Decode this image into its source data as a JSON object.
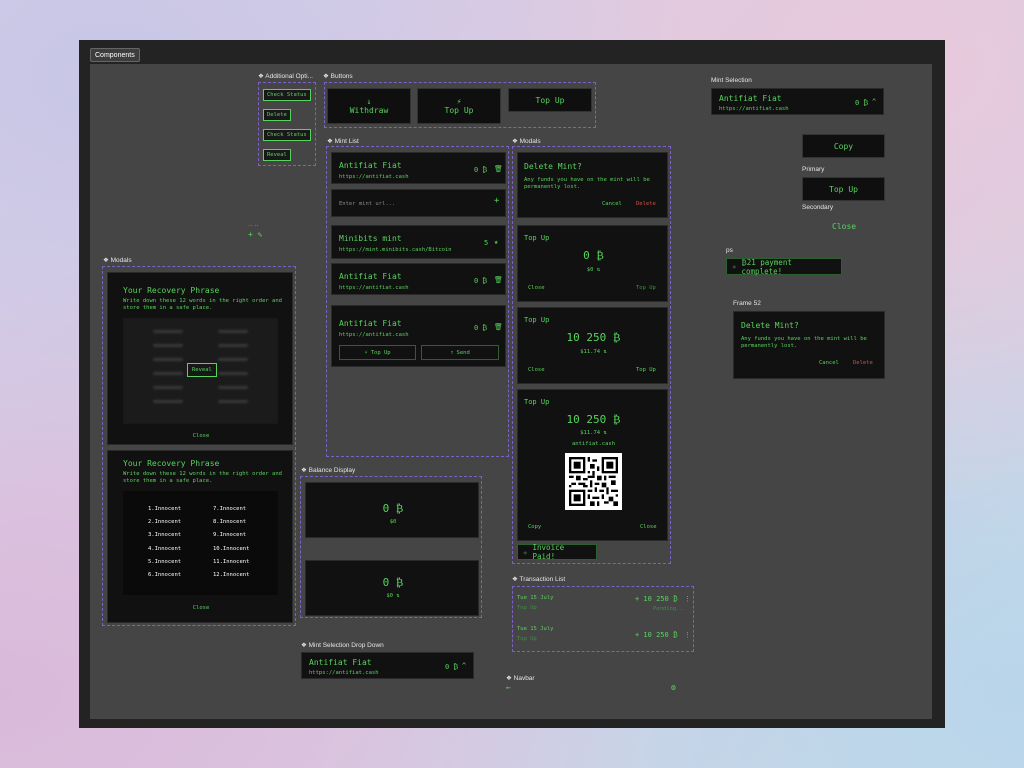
{
  "tab": "Components",
  "labels": {
    "additional": "❖ Additional Opti...",
    "buttons": "❖ Buttons",
    "mint_list": "❖ Mint List",
    "modals_center": "❖ Modals",
    "modals_left": "❖ Modals",
    "balance_display": "❖ Balance Display",
    "mint_dropdown": "❖ Mint Selection Drop Down",
    "transaction_list": "❖ Transaction List",
    "navbar": "❖ Navbar",
    "mint_selection": "Mint Selection",
    "primary": "Primary",
    "secondary": "Secondary",
    "ps": "ps",
    "frame52": "Frame 52",
    "dots": "·· ··"
  },
  "additional_options": [
    "Check Status",
    "Delete",
    "Check Status",
    "Reveal"
  ],
  "buttons": {
    "withdraw": "Withdraw",
    "top_up": "Top Up",
    "top_up_plain": "Top Up"
  },
  "mint": {
    "name": "Antifiat Fiat",
    "url": "https://antifiat.cash",
    "balance": "0 ₿"
  },
  "mint_list": {
    "placeholder": "Enter mint url...",
    "minibits_name": "Minibits mint",
    "minibits_url": "https://mint.minibits.cash/Bitcoin",
    "minibits_rating": "5",
    "top_up": "Top Up",
    "send": "Send"
  },
  "delete_modal": {
    "title": "Delete Mint?",
    "body": "Any funds you have on the mint will be permanently lost.",
    "cancel": "Cancel",
    "delete": "Delete"
  },
  "topup1": {
    "title": "Top Up",
    "amount": "0 ₿",
    "fiat": "$0 ⇅",
    "close": "Close",
    "action": "Top Up"
  },
  "topup2": {
    "title": "Top Up",
    "amount": "10 250 ₿",
    "fiat": "$11.74 ⇅",
    "close": "Close",
    "action": "Top Up"
  },
  "topup3": {
    "title": "Top Up",
    "amount": "10 250 ₿",
    "fiat": "$11.74 ⇅",
    "mint": "antifiat.cash",
    "copy": "Copy",
    "close": "Close"
  },
  "invoice_toast": "Invoice Paid!",
  "recovery": {
    "title": "Your Recovery Phrase",
    "body": "Write down these 12 words in the right order and store them in a safe place.",
    "reveal": "Reveal",
    "close": "Close",
    "words_left": [
      "1.Innocent",
      "2.Innocent",
      "3.Innocent",
      "4.Innocent",
      "5.Innocent",
      "6.Innocent"
    ],
    "words_right": [
      "7.Innocent",
      "8.Innocent",
      "9.Innocent",
      "10.Innocent",
      "11.Innocent",
      "12.Innocent"
    ]
  },
  "balance": {
    "a_amount": "0 ₿",
    "a_fiat": "$0",
    "b_amount": "0 ₿",
    "b_fiat": "$0 ⇅"
  },
  "transactions": [
    {
      "date": "Tue 15 July",
      "type": "Top Up",
      "amount": "+ 10 250 ₿",
      "status": "Pending..."
    },
    {
      "date": "Tue 15 July",
      "type": "Top Up",
      "amount": "+ 10 250 ₿",
      "status": ""
    }
  ],
  "right": {
    "copy": "Copy",
    "top_up": "Top Up",
    "close": "Close",
    "payment_toast": "₿21 payment complete!"
  },
  "colors": {
    "accent": "#59d35e",
    "danger": "#d0504a",
    "frame": "#7c61c9"
  }
}
